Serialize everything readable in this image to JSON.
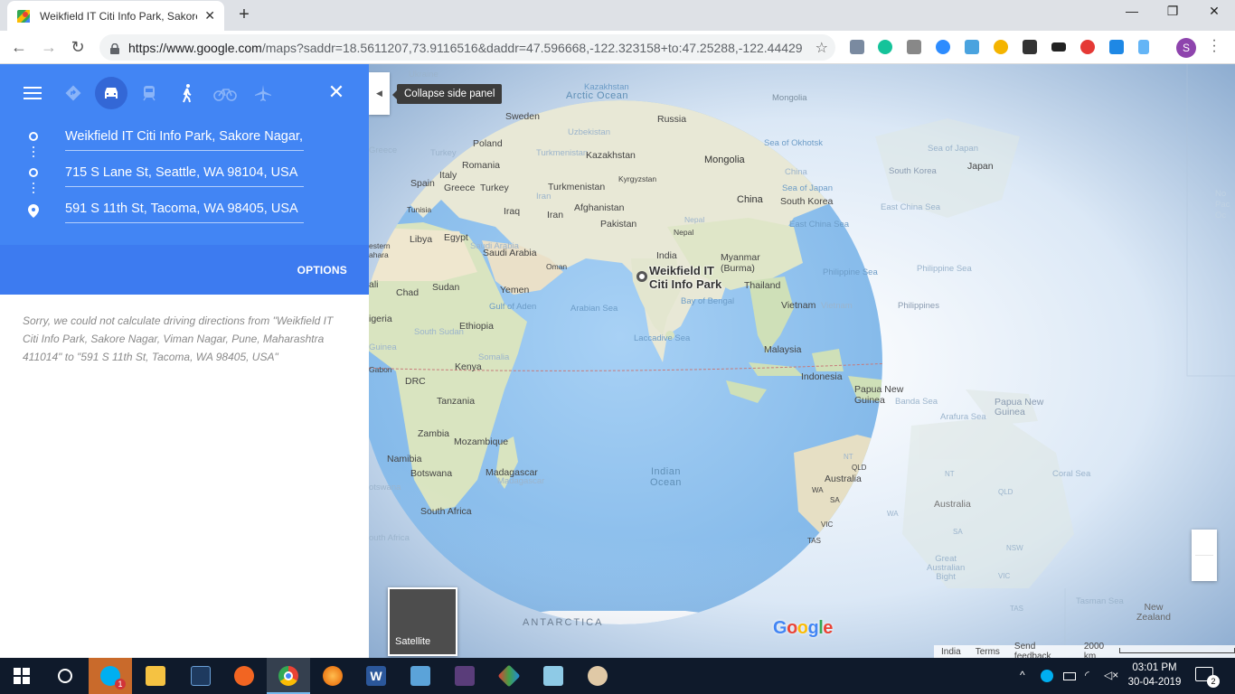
{
  "browser": {
    "tab_title": "Weikfield IT Citi Info Park, Sakore",
    "new_tab_glyph": "+",
    "url_host": "https://www.google.com",
    "url_path": "/maps?saddr=18.5611207,73.9116516&daddr=47.596668,-122.323158+to:47.25288,-122.44429",
    "profile_initial": "S",
    "window_controls": {
      "minimize": "—",
      "maximize": "❐",
      "close": "✕"
    }
  },
  "directions": {
    "waypoints": [
      "Weikfield IT Citi Info Park, Sakore Nagar, Viman Nagar, Pune, Maharashtra 411014",
      "715 S Lane St, Seattle, WA 98104, USA",
      "591 S 11th St, Tacoma, WA 98405, USA"
    ],
    "options_label": "OPTIONS",
    "error_message": "Sorry, we could not calculate driving directions from \"Weikfield IT Citi Info Park, Sakore Nagar, Viman Nagar, Pune, Maharashtra 411014\" to \"591 S 11th St, Tacoma, WA 98405, USA\"",
    "travel_modes": [
      "best-route",
      "driving",
      "transit",
      "walking",
      "cycling",
      "flights"
    ],
    "active_mode": "driving"
  },
  "map": {
    "collapse_tooltip": "Collapse side panel",
    "place_label_line1": "Weikfield IT",
    "place_label_line2": "Citi Info Park",
    "satellite_label": "Satellite",
    "footer": {
      "region": "India",
      "terms": "Terms",
      "feedback": "Send feedback",
      "scale": "2000 km"
    },
    "labels": {
      "ukraine": "Ukraine",
      "kazakhstan_top": "Kazakhstan",
      "arctic_ocean": "Arctic Ocean",
      "mongolia_top": "Mongolia",
      "sweden": "Sweden",
      "russia": "Russia",
      "uzbekistan": "Uzbekistan",
      "poland": "Poland",
      "sea_of_okhotsk": "Sea of Okhotsk",
      "sea_of_japan_right": "Sea of Japan",
      "greece_left": "Greece",
      "turkey_faint": "Turkey",
      "turkmenistan_faint": "Turkmenistan",
      "kazakhstan": "Kazakhstan",
      "mongolia": "Mongolia",
      "romania": "Romania",
      "japan": "Japan",
      "south_korea_right": "South Korea",
      "kyrgyzstan": "Kyrgyzstan",
      "italy": "Italy",
      "china_faint": "China",
      "spain": "Spain",
      "greece": "Greece",
      "turkey": "Turkey",
      "turkmenistan": "Turkmenistan",
      "sea_of_japan": "Sea of Japan",
      "iran_faint": "Iran",
      "tunisia": "Tunisia",
      "china": "China",
      "south_korea": "South Korea",
      "afghanistan": "Afghanistan",
      "iraq": "Iraq",
      "iran": "Iran",
      "east_china_sea_right": "East China Sea",
      "nepal_faint": "Nepal",
      "pakistan": "Pakistan",
      "east_china_sea": "East China Sea",
      "libya": "Libya",
      "egypt": "Egypt",
      "nepal": "Nepal",
      "western_sahara": "estern\nahara",
      "saudi_faint": "Saudi Arabia",
      "myanmar": "Myanmar\n(Burma)",
      "india": "India",
      "saudi_arabia": "Saudi Arabia",
      "philippine_sea": "Philippine Sea",
      "philippine_sea_right": "Philippine Sea",
      "oman": "Oman",
      "mali": "ali",
      "thailand": "Thailand",
      "chad": "Chad",
      "sudan": "Sudan",
      "yemen": "Yemen",
      "bay_of_bengal": "Bay of Bengal",
      "vietnam_faint": "Vietnam",
      "philippines_right": "Philippines",
      "vietnam": "Vietnam",
      "gulf_of_aden": "Gulf of Aden",
      "arabian_sea": "Arabian Sea",
      "nigeria": "igeria",
      "ethiopia": "Ethiopia",
      "south_sudan": "South Sudan",
      "laccadive_sea": "Laccadive Sea",
      "malaysia": "Malaysia",
      "somalia": "Somalia",
      "guinea_faint": "Guinea",
      "gabon": "Gabon",
      "kenya": "Kenya",
      "indonesia": "Indonesia",
      "drc": "DRC",
      "papua_new_guinea": "Papua New\nGuinea",
      "papua_new_guinea_right": "Papua New\nGuinea",
      "banda_sea": "Banda Sea",
      "tanzania": "Tanzania",
      "arafura_sea": "Arafura Sea",
      "zambia": "Zambia",
      "mozambique": "Mozambique",
      "madagascar_faint": "Madagascar",
      "namibia": "Namibia",
      "madagascar": "Madagascar",
      "nt_left": "NT",
      "coral_sea": "Coral Sea",
      "nt_right": "NT",
      "qld_left": "QLD",
      "botswana": "Botswana",
      "botswana_faint": "otswana",
      "indian_ocean": "Indian\nOcean",
      "australia": "Australia",
      "wa_left": "WA",
      "sa_left": "SA",
      "qld_right": "QLD",
      "australia_right": "Australia",
      "south_africa": "South Africa",
      "south_africa_faint": "outh Africa",
      "wa_right": "WA",
      "sa_right": "SA",
      "vic": "VIC",
      "nsw": "NSW",
      "tas": "TAS",
      "great_australian_bight": "Great\nAustralian\nBight",
      "vic_right": "VIC",
      "tasman_sea": "Tasman Sea",
      "new_zealand": "New\nZealand",
      "tas_right": "TAS",
      "antarctica": "ANTARCTICA",
      "north_pacific": "No\nPac\nOc"
    }
  },
  "taskbar": {
    "clock_time": "03:01 PM",
    "clock_date": "30-04-2019",
    "notification_count": "2",
    "skype_badge": "1"
  },
  "colors": {
    "maps_blue": "#4285f4",
    "maps_blue_dark": "#3367d6",
    "taskbar": "#0f1a2b"
  }
}
